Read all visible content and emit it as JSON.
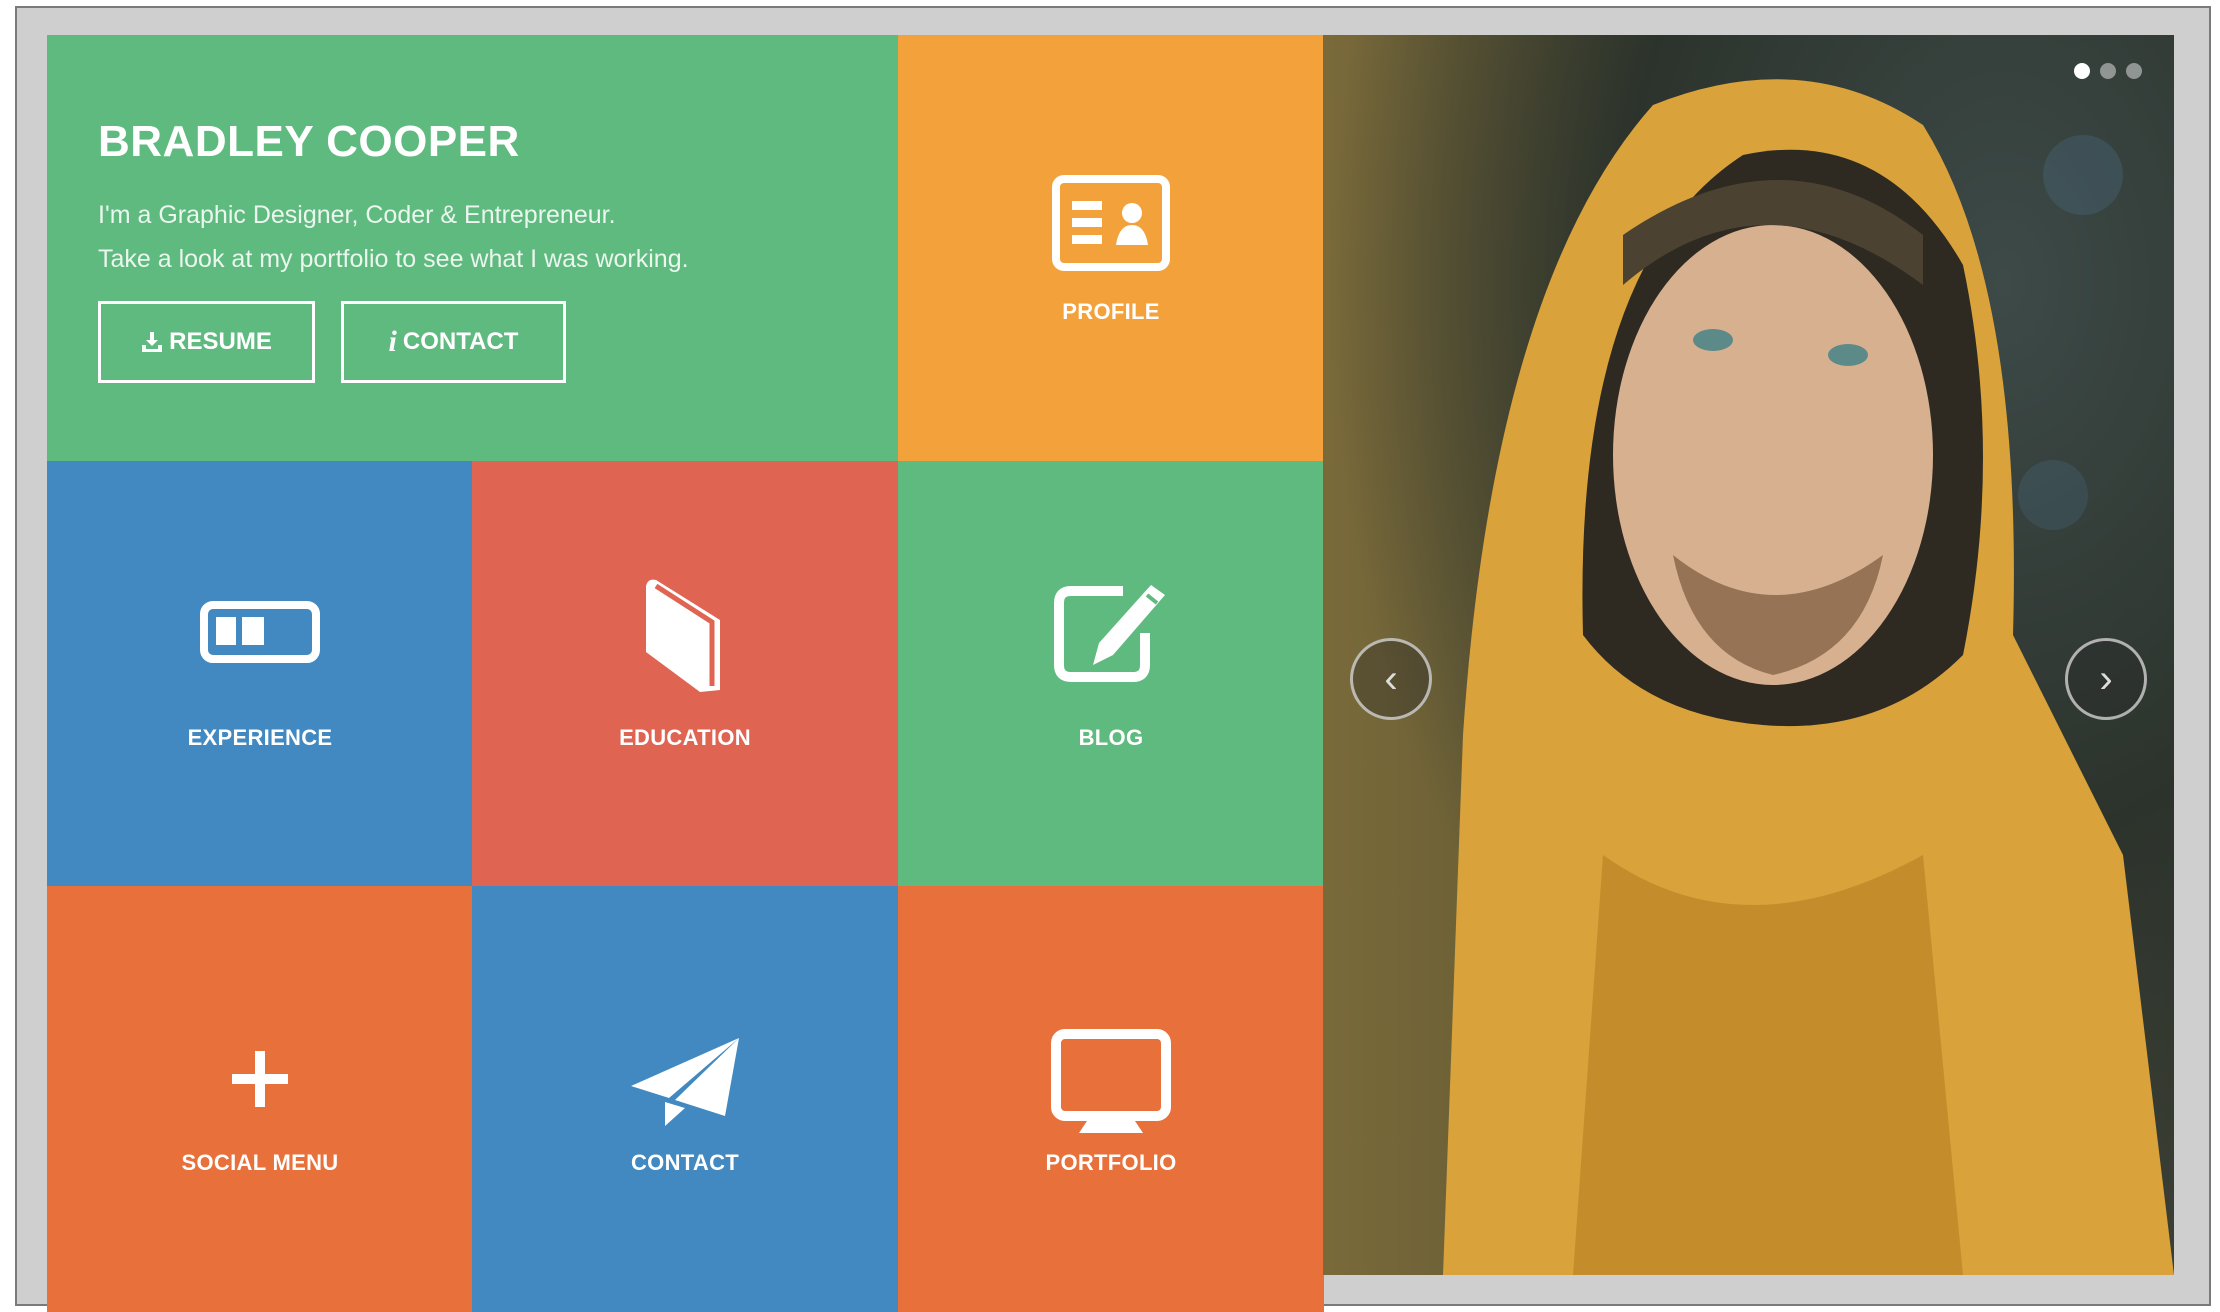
{
  "hero": {
    "name": "BRADLEY COOPER",
    "line1": "I'm a Graphic Designer, Coder & Entrepreneur.",
    "line2": "Take a look at my portfolio to see what I was working.",
    "resume_button": "RESUME",
    "contact_button": "CONTACT",
    "contact_icon_glyph": "i",
    "color": "#5fba7f"
  },
  "tiles": [
    {
      "label": "PROFILE",
      "icon": "id-card-icon",
      "color": "#f3a13b"
    },
    {
      "label": "EXPERIENCE",
      "icon": "experience-icon",
      "color": "#4189c0"
    },
    {
      "label": "EDUCATION",
      "icon": "book-icon",
      "color": "#e06452"
    },
    {
      "label": "BLOG",
      "icon": "edit-icon",
      "color": "#5fba7f"
    },
    {
      "label": "SOCIAL MENU",
      "icon": "plus-icon",
      "color": "#e8703b"
    },
    {
      "label": "CONTACT",
      "icon": "paper-plane-icon",
      "color": "#4189c0"
    },
    {
      "label": "PORTFOLIO",
      "icon": "monitor-icon",
      "color": "#e8703b"
    }
  ],
  "slider": {
    "slides": 3,
    "active": 1,
    "prev_glyph": "‹",
    "next_glyph": "›"
  }
}
